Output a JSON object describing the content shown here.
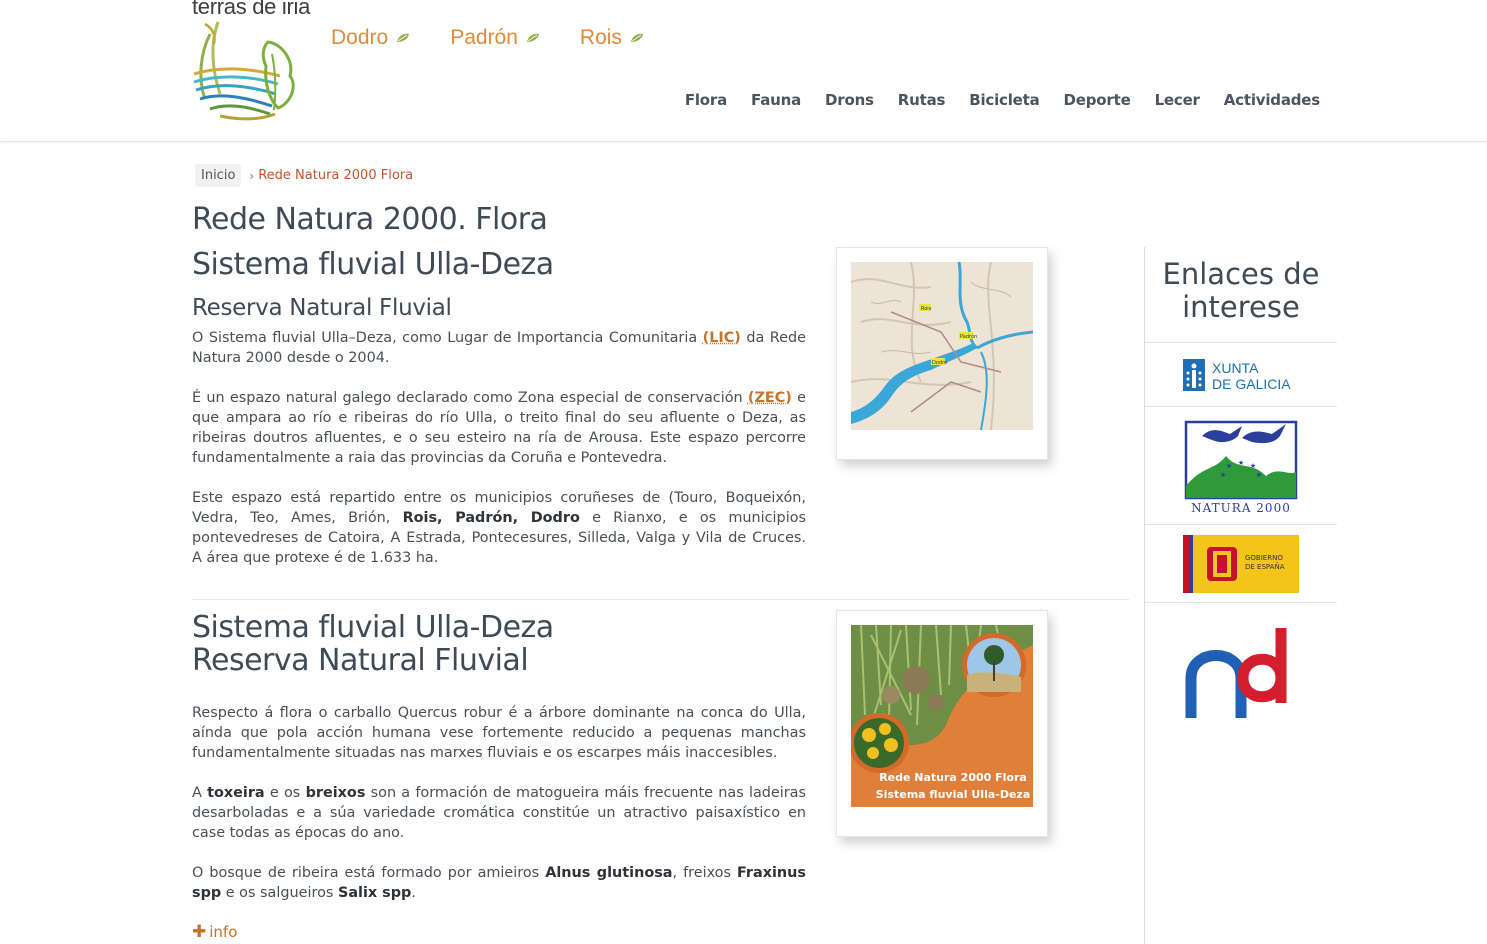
{
  "header": {
    "site_title": "terras de iria",
    "towns": [
      "Dodro",
      "Padrón",
      "Rois"
    ],
    "nav": [
      "Flora",
      "Fauna",
      "Drons",
      "Rutas",
      "Bicicleta",
      "Deporte",
      "Lecer",
      "Actividades"
    ]
  },
  "breadcrumb": {
    "home": "Inicio",
    "separator": "›",
    "current": "Rede Natura 2000 Flora"
  },
  "section1": {
    "page_title": "Rede Natura 2000. Flora",
    "heading": "Sistema fluvial Ulla-Deza",
    "subheading": "Reserva Natural Fluvial",
    "p1_a": "O Sistema fluvial Ulla–Deza, como Lugar de Importancia Comunitaria ",
    "p1_link": "(LIC)",
    "p1_b": " da Rede Natura 2000 desde o 2004.",
    "p2_a": "É un espazo natural galego declarado como Zona especial de conservación ",
    "p2_link": "(ZEC)",
    "p2_b": " e que ampara ao río e ribeiras do río Ulla, o treito final do seu afluente o Deza, as ribeiras doutros afluentes, e o seu esteiro na ría de Arousa. Este espazo percorre fundamentalmente a raia das provincias da Coruña e Pontevedra.",
    "p3_a": "Este espazo está repartido entre os municipios coruñeses de (Touro, Boqueixón, Vedra, Teo, Ames, Brión, ",
    "p3_bold": "Rois, Padrón, Dodro",
    "p3_b": " e Rianxo, e os municipios pontevedreses de Catoira, A Estrada, Pontecesures, Silleda, Valga y Vila de Cruces. A área que protexe é de 1.633 ha.",
    "map_labels": [
      "Rois",
      "Padrón",
      "Dodro"
    ]
  },
  "section2": {
    "heading_line1": "Sistema fluvial Ulla-Deza",
    "heading_line2": "Reserva Natural Fluvial",
    "p1": "Respecto á flora o carballo Quercus robur é a árbore dominante na conca do Ulla, aínda que pola acción humana vese fortemente reducido a pequenas manchas fundamentalmente situadas nas marxes fluviais e os escarpes máis inaccesibles.",
    "p2_a": "A ",
    "p2_b1": "toxeira",
    "p2_c": " e os ",
    "p2_b2": "breixos",
    "p2_d": " son a formación de matogueira máis frecuente nas ladeiras desarboladas e a súa variedade cromática constitúe un atractivo paisaxístico en case todas as épocas do ano.",
    "p3_a": "O bosque de ribeira está formado por amieiros ",
    "p3_b1": "Alnus glutinosa",
    "p3_c": ", freixos ",
    "p3_b2": "Fraxinus spp",
    "p3_d": " e os salgueiros ",
    "p3_b3": "Salix spp",
    "p3_e": ".",
    "poster_line1": "Rede Natura 2000 Flora",
    "poster_line2": "Sistema fluvial Ulla-Deza",
    "more_label": "info"
  },
  "sidebar": {
    "title_line1": "Enlaces de",
    "title_line2": "interese",
    "xunta_line1": "XUNTA",
    "xunta_line2": "DE GALICIA",
    "natura_label": "NATURA 2000",
    "gobierno_line1": "GOBIERNO",
    "gobierno_line2": "DE ESPAÑA"
  },
  "colors": {
    "accent": "#e08a3c",
    "link": "#c8722c",
    "heading": "#3e4a55",
    "xunta_blue": "#1f6fb4",
    "natura_blue": "#2b3f9c",
    "natura_green": "#2e9a3c"
  }
}
